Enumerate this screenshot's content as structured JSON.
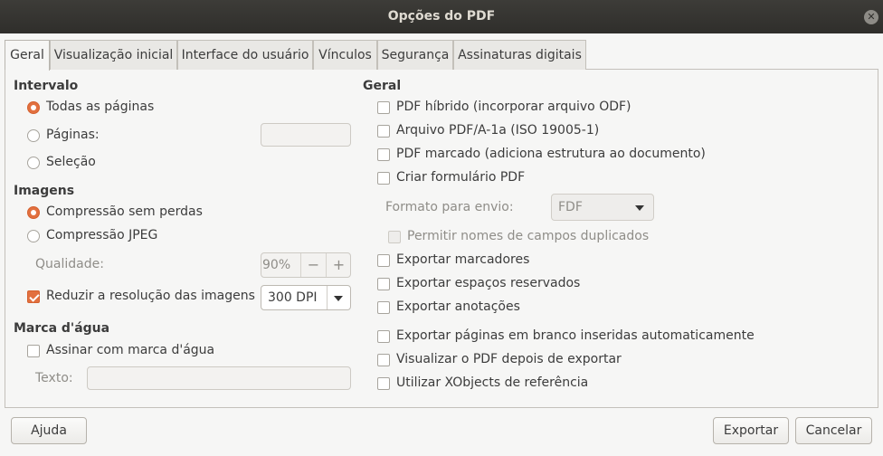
{
  "window": {
    "title": "Opções do PDF",
    "close_glyph": "✕"
  },
  "tabs": [
    {
      "label": "Geral"
    },
    {
      "label": "Visualização inicial"
    },
    {
      "label": "Interface do usuário"
    },
    {
      "label": "Vínculos"
    },
    {
      "label": "Segurança"
    },
    {
      "label": "Assinaturas digitais"
    }
  ],
  "range": {
    "heading": "Intervalo",
    "all_pages": "Todas as páginas",
    "pages": "Páginas:",
    "pages_value": "",
    "selection": "Seleção"
  },
  "images": {
    "heading": "Imagens",
    "lossless": "Compressão sem perdas",
    "jpeg": "Compressão JPEG",
    "quality_label": "Qualidade:",
    "quality_value": "90%",
    "minus": "−",
    "plus": "+",
    "reduce_resolution": "Reduzir a resolução das imagens",
    "dpi_value": "300 DPI"
  },
  "watermark": {
    "heading": "Marca d'água",
    "sign": "Assinar com marca d'água",
    "text_label": "Texto:",
    "text_value": ""
  },
  "general": {
    "heading": "Geral",
    "hybrid": "PDF híbrido (incorporar arquivo ODF)",
    "pdfa": "Arquivo PDF/A-1a (ISO 19005-1)",
    "tagged": "PDF marcado (adiciona estrutura ao documento)",
    "create_form": "Criar formulário PDF",
    "submit_format_label": "Formato para envio:",
    "submit_format_value": "FDF",
    "allow_duplicate_names": "Permitir nomes de campos duplicados",
    "export_bookmarks": "Exportar marcadores",
    "export_placeholders": "Exportar espaços reservados",
    "export_comments": "Exportar anotações",
    "export_blank_pages": "Exportar páginas em branco inseridas automaticamente",
    "view_after_export": "Visualizar o PDF depois de exportar",
    "reference_xobjects": "Utilizar XObjects de referência"
  },
  "buttons": {
    "help": "Ajuda",
    "export": "Exportar",
    "cancel": "Cancelar"
  },
  "colors": {
    "accent": "#e2703f",
    "titlebar": "#2f2e2b",
    "window_bg": "#f6f6f5"
  }
}
